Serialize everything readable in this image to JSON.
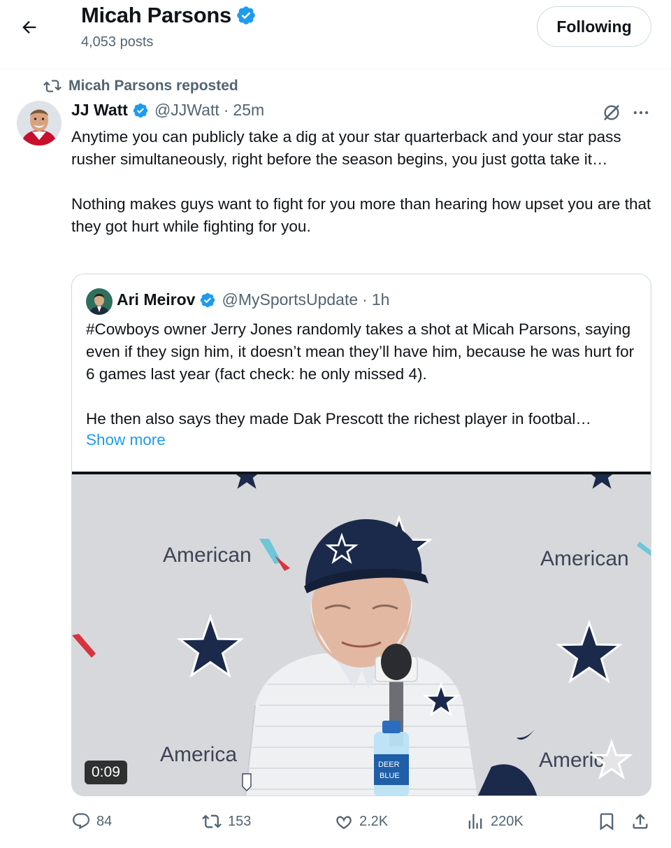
{
  "header": {
    "profile_name": "Micah Parsons",
    "post_count": "4,053 posts",
    "follow_label": "Following"
  },
  "repost": {
    "label": "Micah Parsons reposted"
  },
  "tweet": {
    "author_name": "JJ Watt",
    "author_handle": "@JJWatt",
    "separator": "·",
    "time": "25m",
    "text": "Anytime you can publicly take a dig at your star quarterback and your star pass rusher simultaneously, right before the season begins, you just gotta take it…\n\nNothing makes guys want to fight for you more than hearing how upset you are that they got hurt while fighting for you."
  },
  "quote": {
    "author_name": "Ari Meirov",
    "author_handle": "@MySportsUpdate",
    "separator": "·",
    "time": "1h",
    "text": "#Cowboys owner Jerry Jones randomly takes a shot at Micah Parsons, saying even if they sign him, it doesn’t mean they’ll have him, because he was hurt for 6 games last year (fact check: he only missed 4).\n\nHe then also says they made Dak Prescott the richest player in footbal…",
    "show_more": "Show more",
    "video": {
      "duration": "0:09",
      "backdrop_text_1": "American",
      "backdrop_text_2": "American",
      "backdrop_text_3": "America",
      "backdrop_text_4": "Americ"
    }
  },
  "actions": {
    "replies": "84",
    "reposts": "153",
    "likes": "2.2K",
    "views": "220K"
  },
  "colors": {
    "verified": "#1d9bf0",
    "link": "#1d9bf0",
    "secondary_text": "#536471",
    "primary_text": "#0f1419",
    "star_navy": "#1b2a4a"
  },
  "icons": {
    "back": "arrow-left-icon",
    "repost": "repost-icon",
    "verified": "verified-badge-icon",
    "grok": "grok-icon",
    "more": "more-icon",
    "reply": "reply-icon",
    "like": "heart-icon",
    "views": "views-icon",
    "bookmark": "bookmark-icon",
    "share": "share-icon"
  }
}
